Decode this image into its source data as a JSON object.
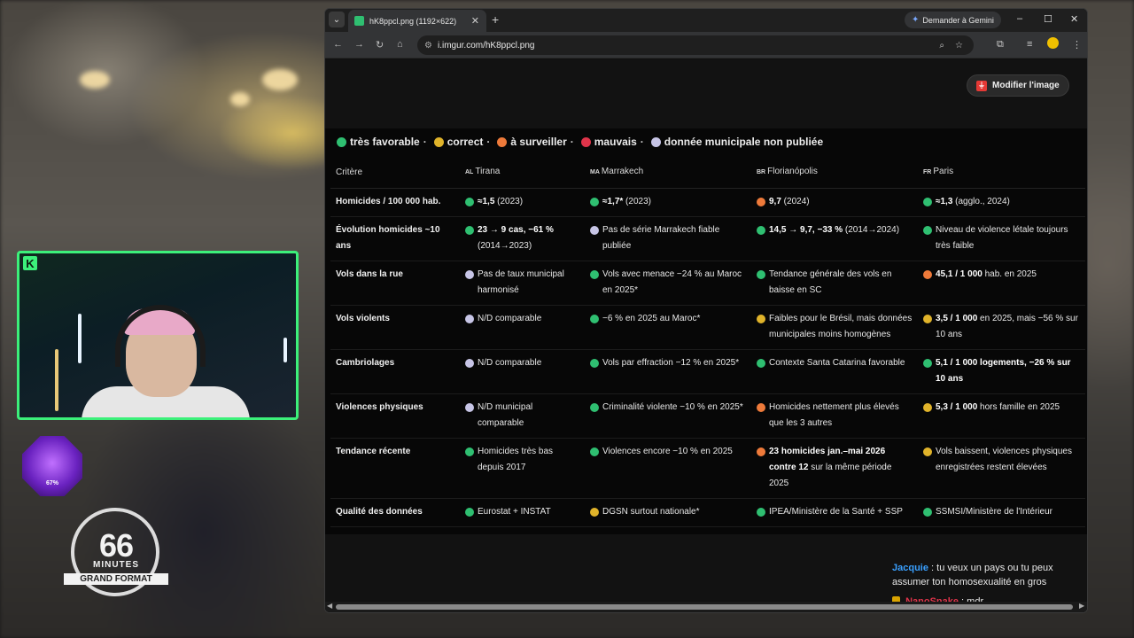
{
  "browser": {
    "tab_title": "hK8ppcl.png (1192×622)",
    "new_tab_label": "+",
    "gemini_label": "Demander à Gemini",
    "url": "i.imgur.com/hK8ppcl.png",
    "window_controls": {
      "minimize": "–",
      "maximize": "☐",
      "close": "✕"
    }
  },
  "page": {
    "edit_button_label": "Modifier l'image",
    "legend": [
      {
        "color": "#2fbf71",
        "label": "très favorable"
      },
      {
        "color": "#e0b32a",
        "label": "correct"
      },
      {
        "color": "#ee7a3a",
        "label": "à surveiller"
      },
      {
        "color": "#e0344a",
        "label": "mauvais"
      },
      {
        "color": "#c7c5e6",
        "label": "donnée municipale non publiée"
      }
    ],
    "table": {
      "headers": [
        {
          "code": "",
          "label": "Critère"
        },
        {
          "code": "AL",
          "label": "Tirana"
        },
        {
          "code": "MA",
          "label": "Marrakech"
        },
        {
          "code": "BR",
          "label": "Florianópolis"
        },
        {
          "code": "FR",
          "label": "Paris"
        }
      ],
      "rows": [
        {
          "criterion": "Homicides / 100 000 hab.",
          "cells": [
            {
              "color": "#2fbf71",
              "bold": "≈1,5",
              "text": " (2023)"
            },
            {
              "color": "#2fbf71",
              "bold": "≈1,7*",
              "text": " (2023)"
            },
            {
              "color": "#ee7a3a",
              "bold": "9,7",
              "text": " (2024)"
            },
            {
              "color": "#2fbf71",
              "bold": "≈1,3",
              "text": " (agglo., 2024)"
            }
          ]
        },
        {
          "criterion": "Évolution homicides ~10 ans",
          "cells": [
            {
              "color": "#2fbf71",
              "bold": "23 → 9 cas, −61 %",
              "text": " (2014→2023)"
            },
            {
              "color": "#c7c5e6",
              "bold": "",
              "text": "Pas de série Marrakech fiable publiée"
            },
            {
              "color": "#2fbf71",
              "bold": "14,5 → 9,7, −33 %",
              "text": " (2014→2024)"
            },
            {
              "color": "#2fbf71",
              "bold": "",
              "text": "Niveau de violence létale toujours très faible"
            }
          ]
        },
        {
          "criterion": "Vols dans la rue",
          "cells": [
            {
              "color": "#c7c5e6",
              "bold": "",
              "text": "Pas de taux municipal harmonisé"
            },
            {
              "color": "#2fbf71",
              "bold": "",
              "text": "Vols avec menace −24 % au Maroc en 2025*"
            },
            {
              "color": "#2fbf71",
              "bold": "",
              "text": "Tendance générale des vols en baisse en SC"
            },
            {
              "color": "#ee7a3a",
              "bold": "45,1 / 1 000",
              "text": " hab. en 2025"
            }
          ]
        },
        {
          "criterion": "Vols violents",
          "cells": [
            {
              "color": "#c7c5e6",
              "bold": "",
              "text": "N/D comparable"
            },
            {
              "color": "#2fbf71",
              "bold": "",
              "text": "−6 % en 2025 au Maroc*"
            },
            {
              "color": "#e0b32a",
              "bold": "",
              "text": "Faibles pour le Brésil, mais données municipales moins homogènes"
            },
            {
              "color": "#e0b32a",
              "bold": "3,5 / 1 000",
              "text": " en 2025, mais −56 % sur 10 ans"
            }
          ]
        },
        {
          "criterion": "Cambriolages",
          "cells": [
            {
              "color": "#c7c5e6",
              "bold": "",
              "text": "N/D comparable"
            },
            {
              "color": "#2fbf71",
              "bold": "",
              "text": "Vols par effraction −12 % en 2025*"
            },
            {
              "color": "#2fbf71",
              "bold": "",
              "text": "Contexte Santa Catarina favorable"
            },
            {
              "color": "#2fbf71",
              "bold": "5,1 / 1 000 logements, −26 % sur 10 ans",
              "text": ""
            }
          ]
        },
        {
          "criterion": "Violences physiques",
          "cells": [
            {
              "color": "#c7c5e6",
              "bold": "",
              "text": "N/D municipal comparable"
            },
            {
              "color": "#2fbf71",
              "bold": "",
              "text": "Criminalité violente −10 % en 2025*"
            },
            {
              "color": "#ee7a3a",
              "bold": "",
              "text": "Homicides nettement plus élevés que les 3 autres"
            },
            {
              "color": "#e0b32a",
              "bold": "5,3 / 1 000",
              "text": " hors famille en 2025"
            }
          ]
        },
        {
          "criterion": "Tendance récente",
          "cells": [
            {
              "color": "#2fbf71",
              "bold": "",
              "text": "Homicides très bas depuis 2017"
            },
            {
              "color": "#2fbf71",
              "bold": "",
              "text": "Violences encore −10 % en 2025"
            },
            {
              "color": "#ee7a3a",
              "bold": "23 homicides jan.–mai 2026 contre 12",
              "text": " sur la même période 2025"
            },
            {
              "color": "#e0b32a",
              "bold": "",
              "text": "Vols baissent, violences physiques enregistrées restent élevées"
            }
          ]
        },
        {
          "criterion": "Qualité des données",
          "cells": [
            {
              "color": "#2fbf71",
              "bold": "",
              "text": "Eurostat + INSTAT"
            },
            {
              "color": "#e0b32a",
              "bold": "",
              "text": "DGSN surtout nationale*"
            },
            {
              "color": "#2fbf71",
              "bold": "",
              "text": "IPEA/Ministère de la Santé + SSP"
            },
            {
              "color": "#2fbf71",
              "bold": "",
              "text": "SSMSI/Ministère de l'Intérieur"
            }
          ]
        }
      ]
    }
  },
  "chat": [
    {
      "user": "Jacquie",
      "message": "tu veux un pays ou tu peux assumer ton homosexualité en gros"
    },
    {
      "user": "NanoSnake",
      "message": "mdr"
    }
  ],
  "overlay": {
    "level_percent": "67%",
    "logo_number": "66",
    "logo_minutes": "MINUTES",
    "logo_subtitle": "GRAND FORMAT",
    "webcam_badge": "K"
  }
}
